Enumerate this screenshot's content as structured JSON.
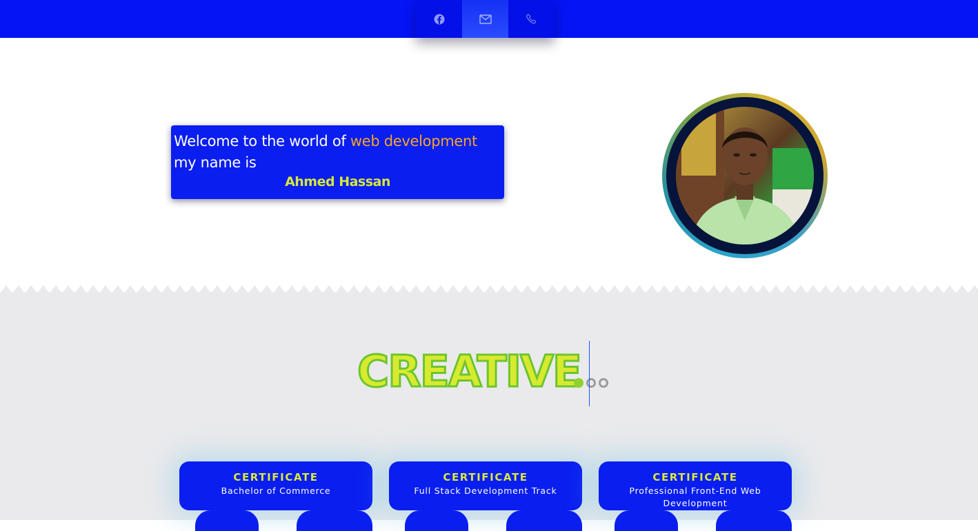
{
  "social": {
    "items": [
      {
        "icon": "facebook-icon",
        "active": false
      },
      {
        "icon": "mail-icon",
        "active": true
      },
      {
        "icon": "phone-icon",
        "active": false
      }
    ]
  },
  "hero": {
    "line1_prefix": "Welcome to the world of ",
    "line1_highlight": "web development",
    "line2": "my name is",
    "name": "Ahmed Hassan"
  },
  "creative": {
    "word": "CREATIVE"
  },
  "certificates": [
    {
      "title": "CERTIFICATE",
      "subtitle": "Bachelor of Commerce"
    },
    {
      "title": "CERTIFICATE",
      "subtitle": "Full Stack Development Track"
    },
    {
      "title": "CERTIFICATE",
      "subtitle": "Professional Front-End Web Development"
    }
  ],
  "colors": {
    "primary": "#0514f5",
    "accent": "#f5a623",
    "highlight": "#d8ea2f",
    "lower_bg": "#eaeaec"
  }
}
